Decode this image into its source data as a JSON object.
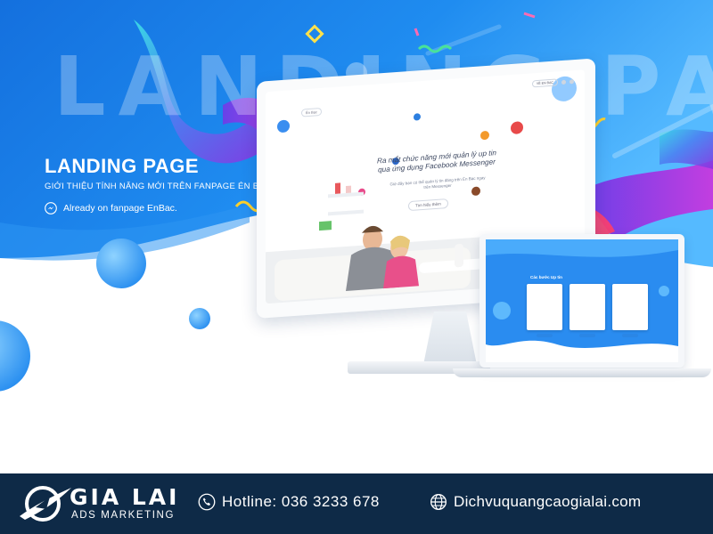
{
  "hero": {
    "background_word": "LANDING PAGE",
    "headline": "LANDING PAGE",
    "subline": "GIỚI THIỆU TÍNH NĂNG MỚI TRÊN FANPAGE ÉN BẠC",
    "fanpage_note": "Already on fanpage EnBac.",
    "fanpage_icon": "messenger-icon"
  },
  "monitor": {
    "title": "Ra mắt chức năng mới quản lý up tin qua ứng dụng Facebook Messenger",
    "subtitle": "Giờ đây bạn có thể quản lý tin đăng trên Én Bạc ngay trên Messenger",
    "button_label": "Tìm hiểu thêm",
    "nav_button_label": "VỀ EN BẠC",
    "logo_label": "Én Bạc"
  },
  "laptop": {
    "heading": "Các bước Up tin"
  },
  "footer": {
    "brand_name": "GIA LAI",
    "brand_sub": "ADS MARKETING",
    "hotline": "Hotline: 036 3233 678",
    "website": "Dichvuquangcaogialai.com",
    "phone_icon": "phone-icon",
    "globe_icon": "globe-icon"
  },
  "colors": {
    "hero_blue": "#1a7ee8",
    "hero_light": "#4fb3ff",
    "footer_navy": "#0e2a47",
    "ribbon_purple": "#7a3fe0",
    "ribbon_cyan": "#34d4e8"
  }
}
